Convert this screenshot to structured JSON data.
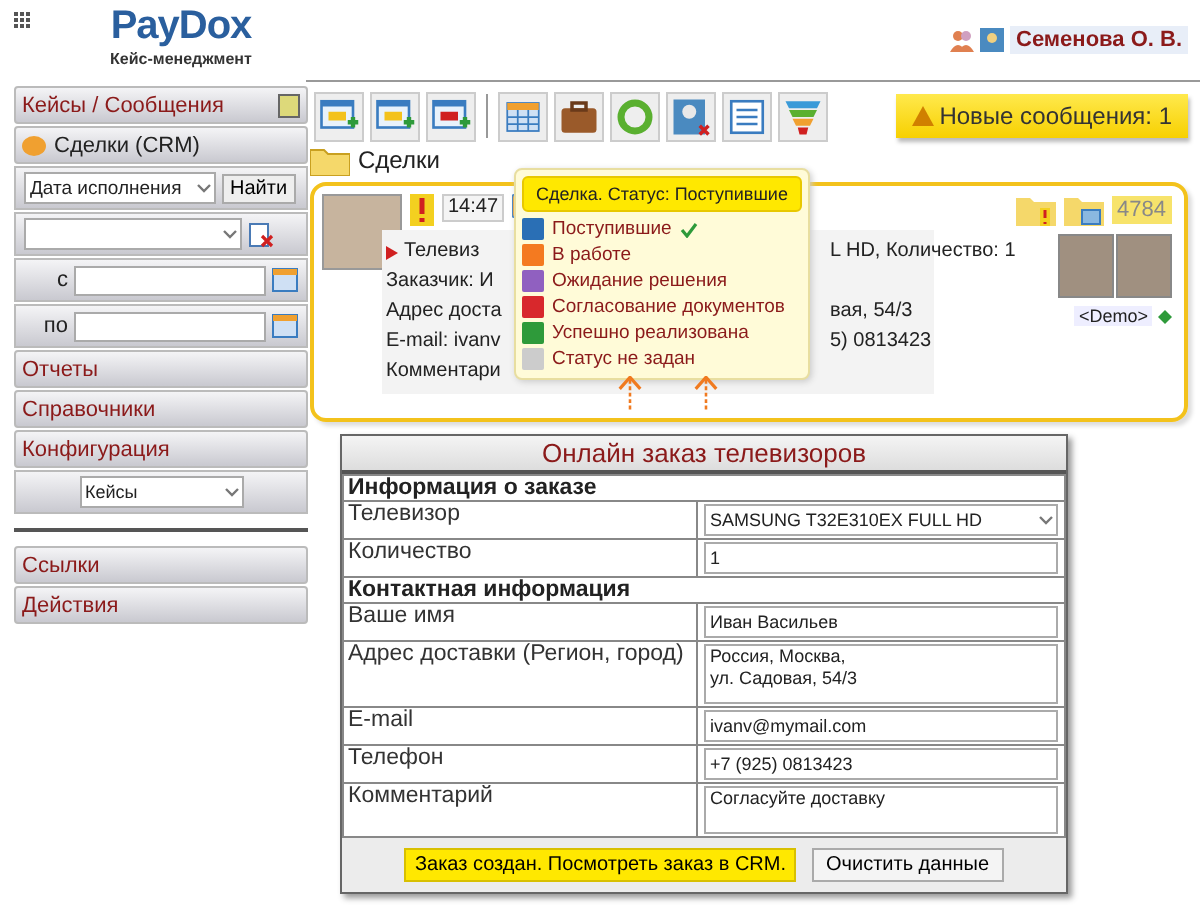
{
  "header": {
    "logo": "PayDox",
    "subtitle": "Кейс-менеджмент",
    "user": "Семенова О. В."
  },
  "sidebar": {
    "title": "Кейсы / Сообщения",
    "deals": "Сделки (CRM)",
    "date_select": "Дата исполнения",
    "find_button": "Найти",
    "from_label": "с",
    "to_label": "по",
    "menu": [
      "Отчеты",
      "Справочники",
      "Конфигурация"
    ],
    "config_select": "Кейсы",
    "links": [
      "Ссылки",
      "Действия"
    ]
  },
  "notification": "Новые сообщения: 1",
  "breadcrumb": "Сделки",
  "card": {
    "time": "14:47",
    "count": "4784",
    "demo": "<Demo>",
    "lines": [
      {
        "left": "Телевиз",
        "right": "L HD, Количество: 1",
        "marker": true
      },
      {
        "left": "Заказчик: И",
        "marker": false
      },
      {
        "left": "Адрес доста",
        "right": "вая, 54/3",
        "marker": false
      },
      {
        "left": "E-mail: ivanv",
        "right": "5) 0813423",
        "marker": false
      },
      {
        "left": "Комментари",
        "marker": false
      }
    ]
  },
  "status_popup": {
    "title": "Сделка. Статус: Поступившие",
    "items": [
      {
        "label": "Поступившие",
        "color": "#2a6fb5",
        "selected": true
      },
      {
        "label": "В работе",
        "color": "#f47a20",
        "selected": false
      },
      {
        "label": "Ожидание решения",
        "color": "#9060c0",
        "selected": false
      },
      {
        "label": "Согласование документов",
        "color": "#d8282c",
        "selected": false
      },
      {
        "label": "Успешно реализована",
        "color": "#2e9a3a",
        "selected": false
      },
      {
        "label": "Статус не задан",
        "color": "#cccccc",
        "selected": false
      }
    ]
  },
  "form": {
    "title": "Онлайн заказ телевизоров",
    "sections": [
      {
        "title": "Информация о заказе",
        "rows": [
          {
            "label": "Телевизор",
            "kind": "select",
            "value": "SAMSUNG T32E310EX FULL HD"
          },
          {
            "label": "Количество",
            "kind": "number",
            "value": "1"
          }
        ]
      },
      {
        "title": "Контактная информация",
        "rows": [
          {
            "label": "Ваше имя",
            "kind": "text",
            "value": "Иван Васильев"
          },
          {
            "label": "Адрес доставки (Регион, город)",
            "kind": "textarea",
            "value": "Россия, Москва,\nул. Садовая, 54/3"
          },
          {
            "label": "E-mail",
            "kind": "text",
            "value": "ivanv@mymail.com"
          },
          {
            "label": "Телефон",
            "kind": "text",
            "value": "+7 (925) 0813423"
          },
          {
            "label": "Комментарий",
            "kind": "textarea",
            "value": "Согласуйте доставку"
          }
        ]
      }
    ],
    "submit_button": "Заказ создан. Посмотреть заказ в CRM.",
    "clear_button": "Очистить данные"
  }
}
